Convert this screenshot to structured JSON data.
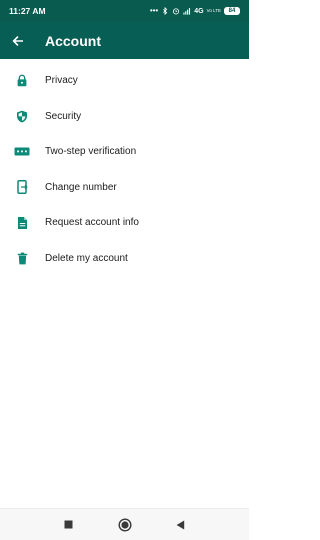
{
  "status_bar": {
    "time": "11:27 AM",
    "dots": "•••",
    "network": "4G",
    "volte": "Vo LTE",
    "battery": "84",
    "icons": [
      "bluetooth-icon",
      "alarm-icon",
      "signal-icon",
      "battery-icon"
    ]
  },
  "app_bar": {
    "title": "Account",
    "back_icon": "arrow-left-icon"
  },
  "menu": {
    "items": [
      {
        "label": "Privacy",
        "icon": "lock-icon"
      },
      {
        "label": "Security",
        "icon": "shield-icon"
      },
      {
        "label": "Two-step verification",
        "icon": "password-dots-icon"
      },
      {
        "label": "Change number",
        "icon": "phone-change-icon"
      },
      {
        "label": "Request account info",
        "icon": "document-icon"
      },
      {
        "label": "Delete my account",
        "icon": "trash-icon"
      }
    ]
  },
  "nav_bar": {
    "buttons": [
      "recents-square-icon",
      "home-circle-icon",
      "back-triangle-icon"
    ]
  },
  "colors": {
    "status_bar": "#0a5b4f",
    "app_bar": "#075e54",
    "icon": "#0c8a78",
    "text": "#1c1c1c"
  }
}
